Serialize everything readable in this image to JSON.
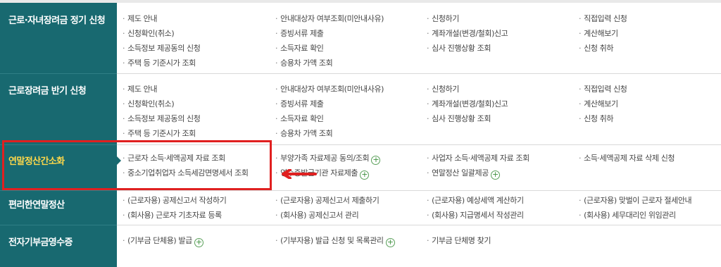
{
  "sections": [
    {
      "title": "근로·자녀장려금 정기 신청",
      "items": [
        {
          "label": "제도 안내",
          "plus": false
        },
        {
          "label": "안내대상자 여부조회(미안내사유)",
          "plus": false
        },
        {
          "label": "신청하기",
          "plus": false
        },
        {
          "label": "직접입력 신청",
          "plus": false
        },
        {
          "label": "신청확인(취소)",
          "plus": false
        },
        {
          "label": "증빙서류 제출",
          "plus": false
        },
        {
          "label": "계좌개설(변경/철회)신고",
          "plus": false
        },
        {
          "label": "계산해보기",
          "plus": false
        },
        {
          "label": "소득정보 제공동의 신청",
          "plus": false
        },
        {
          "label": "소득자료 확인",
          "plus": false
        },
        {
          "label": "심사 진행상황 조회",
          "plus": false
        },
        {
          "label": "신청 취하",
          "plus": false
        },
        {
          "label": "주택 등 기준시가 조회",
          "plus": false
        },
        {
          "label": "승용차 가액 조회",
          "plus": false
        }
      ]
    },
    {
      "title": "근로장려금 반기 신청",
      "items": [
        {
          "label": "제도 안내",
          "plus": false
        },
        {
          "label": "안내대상자 여부조회(미안내사유)",
          "plus": false
        },
        {
          "label": "신청하기",
          "plus": false
        },
        {
          "label": "직접입력 신청",
          "plus": false
        },
        {
          "label": "신청확인(취소)",
          "plus": false
        },
        {
          "label": "증빙서류 제출",
          "plus": false
        },
        {
          "label": "계좌개설(변경/철회)신고",
          "plus": false
        },
        {
          "label": "계산해보기",
          "plus": false
        },
        {
          "label": "소득정보 제공동의 신청",
          "plus": false
        },
        {
          "label": "소득자료 확인",
          "plus": false
        },
        {
          "label": "심사 진행상황 조회",
          "plus": false
        },
        {
          "label": "신청 취하",
          "plus": false
        },
        {
          "label": "주택 등 기준시가 조회",
          "plus": false
        },
        {
          "label": "승용차 가액 조회",
          "plus": false
        }
      ]
    },
    {
      "title": "연말정산간소화",
      "items": [
        {
          "label": "근로자 소득·세액공제 자료 조회",
          "plus": false
        },
        {
          "label": "부양가족 자료제공 동의/조회",
          "plus": true
        },
        {
          "label": "사업자 소득·세액공제 자료 조회",
          "plus": false
        },
        {
          "label": "소득·세액공제 자료 삭제 신청",
          "plus": false
        },
        {
          "label": "중소기업취업자 소득세감면명세서 조회",
          "plus": false
        },
        {
          "label": "영수증발급기관 자료제출",
          "plus": true
        },
        {
          "label": "연말정산 일괄제공",
          "plus": true
        }
      ]
    },
    {
      "title": "편리한연말정산",
      "items": [
        {
          "label": "(근로자용) 공제신고서 작성하기",
          "plus": false
        },
        {
          "label": "(근로자용) 공제신고서 제출하기",
          "plus": false
        },
        {
          "label": "(근로자용) 예상세액 계산하기",
          "plus": false
        },
        {
          "label": "(근로자용) 맞벌이 근로자 절세안내",
          "plus": false
        },
        {
          "label": "(회사용) 근로자 기초자료 등록",
          "plus": false
        },
        {
          "label": "(회사용) 공제신고서 관리",
          "plus": false
        },
        {
          "label": "(회사용) 지급명세서 작성관리",
          "plus": false
        },
        {
          "label": "(회사용) 세무대리인 위임관리",
          "plus": false
        }
      ]
    },
    {
      "title": "전자기부금영수증",
      "items": [
        {
          "label": "(기부금 단체용) 발급",
          "plus": true
        },
        {
          "label": "(기부자용) 발급 신청 및 목록관리",
          "plus": true
        },
        {
          "label": "기부금 단체명 찾기",
          "plus": false
        }
      ]
    }
  ],
  "active_section_index": 2,
  "colors": {
    "sidebar": "#186970",
    "active_text": "#ffd84a",
    "highlight": "#e02020",
    "plus_icon": "#3d8f3d"
  }
}
